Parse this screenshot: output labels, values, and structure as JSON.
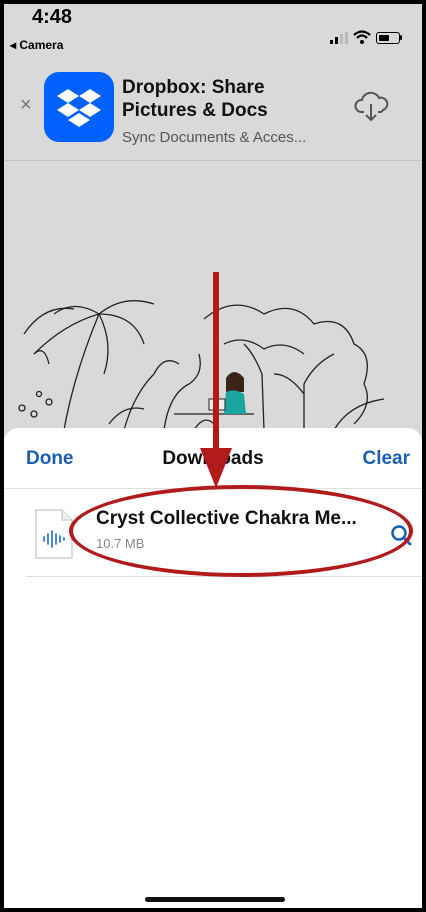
{
  "status_bar": {
    "time": "4:48",
    "back_label": "◂ Camera"
  },
  "app_banner": {
    "close_glyph": "×",
    "title": "Dropbox: Share Pictures & Docs",
    "subtitle": "Sync Documents & Acces...",
    "icon": "dropbox-logo",
    "action_icon": "cloud-download-icon"
  },
  "downloads_sheet": {
    "done_label": "Done",
    "title": "Downloads",
    "clear_label": "Clear",
    "items": [
      {
        "name": "Cryst Collective Chakra Me...",
        "size": "10.7 MB",
        "icon": "audio-file-icon",
        "action_icon": "magnifier-icon"
      }
    ]
  },
  "annotations": {
    "arrow_color": "#b21b1b",
    "oval_color": "#b21b1b"
  },
  "colors": {
    "accent": "#1a5fb4",
    "dropbox_blue": "#0061fe"
  }
}
